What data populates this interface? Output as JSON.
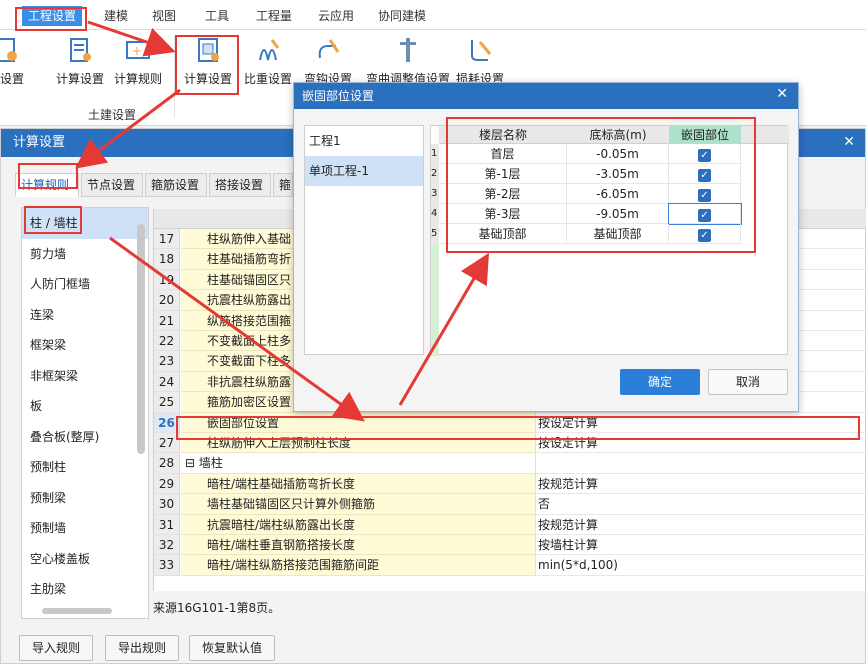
{
  "menubar": {
    "items": [
      {
        "label": "工程设置",
        "active": true
      },
      {
        "label": "建模"
      },
      {
        "label": "视图"
      },
      {
        "label": "工具"
      },
      {
        "label": "工程量"
      },
      {
        "label": "云应用"
      },
      {
        "label": "协同建模"
      }
    ]
  },
  "ribbon": {
    "buttons": [
      {
        "label": "量设置",
        "icon": "settings-icon"
      },
      {
        "label": "计算设置",
        "icon": "calc-settings-icon"
      },
      {
        "label": "计算规则",
        "icon": "calc-rules-icon"
      },
      {
        "label": "计算设置",
        "icon": "calc-settings-icon"
      },
      {
        "label": "比重设置",
        "icon": "density-icon"
      },
      {
        "label": "弯钩设置",
        "icon": "hook-icon"
      },
      {
        "label": "弯曲调整值设置",
        "icon": "bend-icon"
      },
      {
        "label": "损耗设置",
        "icon": "loss-icon"
      }
    ],
    "group_label": "土建设置"
  },
  "calc_window": {
    "title": "计算设置",
    "tabs": [
      "计算规则",
      "节点设置",
      "箍筋设置",
      "搭接设置",
      "箍"
    ],
    "left_items": [
      "柱 / 墙柱",
      "剪力墙",
      "人防门框墙",
      "连梁",
      "框架梁",
      "非框架梁",
      "板",
      "叠合板(整厚)",
      "预制柱",
      "预制梁",
      "预制墙",
      "空心楼盖板",
      "主肋梁"
    ],
    "rows": [
      {
        "num": "17",
        "name": "柱纵筋伸入基础",
        "value": ""
      },
      {
        "num": "18",
        "name": "柱基础插筋弯折",
        "value": ""
      },
      {
        "num": "19",
        "name": "柱基础锚固区只",
        "value": ""
      },
      {
        "num": "20",
        "name": "抗震柱纵筋露出",
        "value": ""
      },
      {
        "num": "21",
        "name": "纵筋搭接范围箍",
        "value": ""
      },
      {
        "num": "22",
        "name": "不变截面上柱多",
        "value": ""
      },
      {
        "num": "23",
        "name": "不变截面下柱多",
        "value": ""
      },
      {
        "num": "24",
        "name": "非抗震柱纵筋露",
        "value": ""
      },
      {
        "num": "25",
        "name": "箍筋加密区设置",
        "value": ""
      },
      {
        "num": "26",
        "name": "嵌固部位设置",
        "value": "按设定计算",
        "highlight": true
      },
      {
        "num": "27",
        "name": "柱纵筋伸入上层预制柱长度",
        "value": "按设定计算"
      },
      {
        "num": "28",
        "name": "墙柱",
        "value": "",
        "group": true
      },
      {
        "num": "29",
        "name": "暗柱/端柱基础插筋弯折长度",
        "value": "按规范计算"
      },
      {
        "num": "30",
        "name": "墙柱基础锚固区只计算外侧箍筋",
        "value": "否"
      },
      {
        "num": "31",
        "name": "抗震暗柱/端柱纵筋露出长度",
        "value": "按规范计算"
      },
      {
        "num": "32",
        "name": "暗柱/端柱垂直钢筋搭接长度",
        "value": "按墙柱计算"
      },
      {
        "num": "33",
        "name": "暗柱/端柱纵筋搭接范围箍筋间距",
        "value": "min(5*d,100)"
      }
    ],
    "source_note": "来源16G101-1第8页。",
    "buttons": {
      "import": "导入规则",
      "export": "导出规则",
      "restore": "恢复默认值"
    }
  },
  "dialog": {
    "title": "嵌固部位设置",
    "projects": [
      "工程1",
      "单项工程-1"
    ],
    "headers": [
      "楼层名称",
      "底标高(m)",
      "嵌固部位"
    ],
    "rows": [
      {
        "num": "1",
        "name": "首层",
        "elev": "-0.05m",
        "checked": true
      },
      {
        "num": "2",
        "name": "第-1层",
        "elev": "-3.05m",
        "checked": true
      },
      {
        "num": "3",
        "name": "第-2层",
        "elev": "-6.05m",
        "checked": true
      },
      {
        "num": "4",
        "name": "第-3层",
        "elev": "-9.05m",
        "checked": true
      },
      {
        "num": "5",
        "name": "基础顶部",
        "elev": "基础顶部",
        "checked": true
      }
    ],
    "ok": "确定",
    "cancel": "取消"
  },
  "colors": {
    "accent": "#2b6fbf",
    "annotation": "#e53935",
    "yellow_cell": "#fffbd6"
  }
}
